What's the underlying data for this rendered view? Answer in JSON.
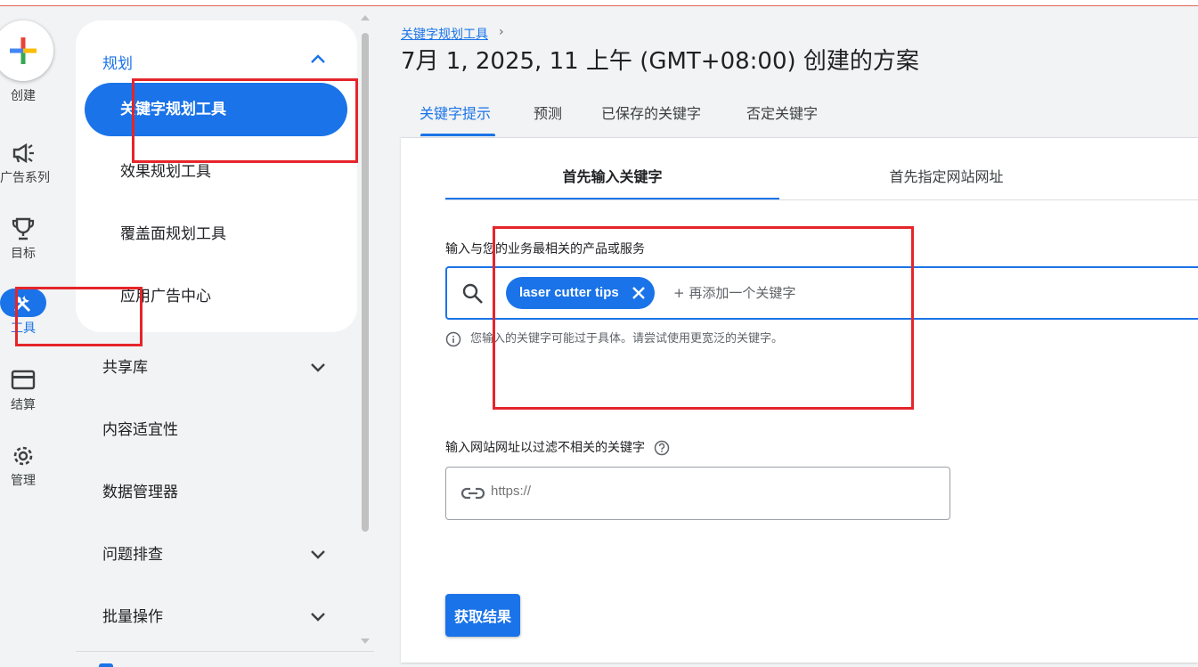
{
  "rail": {
    "create_label": "创建",
    "items": [
      {
        "label": "广告系列"
      },
      {
        "label": "目标"
      },
      {
        "label": "工具"
      },
      {
        "label": "结算"
      },
      {
        "label": "管理"
      }
    ]
  },
  "nav": {
    "section_title": "规划",
    "sub_items": [
      {
        "label": "关键字规划工具"
      },
      {
        "label": "效果规划工具"
      },
      {
        "label": "覆盖面规划工具"
      },
      {
        "label": "应用广告中心"
      }
    ],
    "items": [
      {
        "label": "共享库"
      },
      {
        "label": "内容适宜性"
      },
      {
        "label": "数据管理器"
      },
      {
        "label": "问题排查"
      },
      {
        "label": "批量操作"
      }
    ]
  },
  "header": {
    "breadcrumb": "关键字规划工具",
    "breadcrumb_chevron": "›",
    "title": "7月 1, 2025, 11 上午 (GMT+08:00) 创建的方案"
  },
  "tabs": [
    {
      "label": "关键字提示"
    },
    {
      "label": "预测"
    },
    {
      "label": "已保存的关键字"
    },
    {
      "label": "否定关键字"
    }
  ],
  "subtabs": [
    {
      "label": "首先输入关键字"
    },
    {
      "label": "首先指定网站网址"
    }
  ],
  "form": {
    "keyword_label": "输入与您的业务最相关的产品或服务",
    "keyword_chip": "laser cutter tips",
    "keyword_placeholder": "+ 再添加一个关键字",
    "hint": "您输入的关键字可能过于具体。请尝试使用更宽泛的关键字。",
    "url_label": "输入网站网址以过滤不相关的关键字",
    "url_placeholder": "https://",
    "submit_label": "获取结果"
  },
  "colors": {
    "accent": "#1a73e8",
    "annotation": "#e5252a"
  }
}
